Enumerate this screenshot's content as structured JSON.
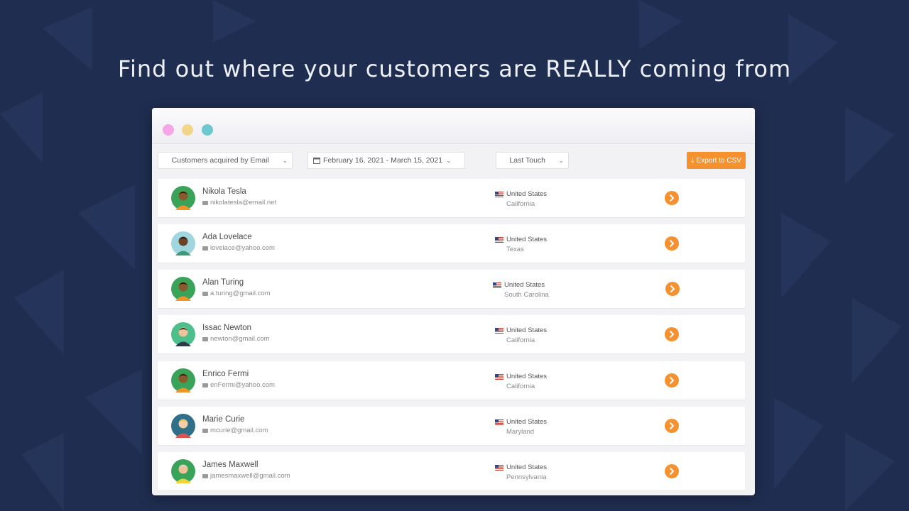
{
  "headline": "Find out where your customers are REALLY coming from",
  "window": {
    "dot_colors": [
      "#f4a6e8",
      "#f0d58a",
      "#6ec8cf"
    ]
  },
  "toolbar": {
    "channel_select": "Customers acquired by Email",
    "date_range": "February 16, 2021 - March 15, 2021",
    "attribution_select": "Last Touch",
    "export_label": "Export to CSV"
  },
  "colors": {
    "accent": "#f5922f",
    "background": "#1f2d50"
  },
  "customers": [
    {
      "name": "Nikola Tesla",
      "email": "nikolatesla@email.net",
      "country": "United States",
      "region": "California"
    },
    {
      "name": "Ada Lovelace",
      "email": "lovelace@yahoo.com",
      "country": "United States",
      "region": "Texas"
    },
    {
      "name": "Alan Turing",
      "email": "a.turing@gmail.com",
      "country": "United States",
      "region": "South Carolina"
    },
    {
      "name": "Issac Newton",
      "email": "newton@gmail.com",
      "country": "United States",
      "region": "California"
    },
    {
      "name": "Enrico Fermi",
      "email": "enFermi@yahoo.com",
      "country": "United States",
      "region": "California"
    },
    {
      "name": "Marie Curie",
      "email": "mcurie@gmail.com",
      "country": "United States",
      "region": "Maryland"
    },
    {
      "name": "James Maxwell",
      "email": "jamesmaxwell@gmail.com",
      "country": "United States",
      "region": "Pennsylvania"
    }
  ]
}
